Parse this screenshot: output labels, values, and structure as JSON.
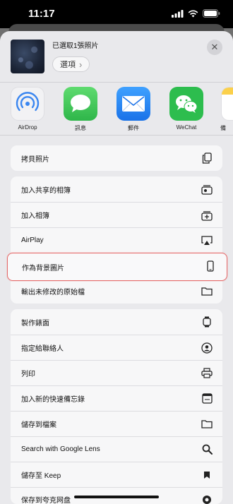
{
  "status": {
    "time": "11:17"
  },
  "header": {
    "title": "已選取1張照片",
    "options_label": "選項",
    "options_chevron": "›",
    "close_glyph": "✕"
  },
  "apps": [
    {
      "name": "airdrop",
      "label": "AirDrop",
      "icon": "airdrop-icon",
      "color": "#4a8ff0"
    },
    {
      "name": "messages",
      "label": "訊息",
      "icon": "messages-icon",
      "color": "#34c759"
    },
    {
      "name": "mail",
      "label": "郵件",
      "icon": "mail-icon",
      "color": "#2b8cf5"
    },
    {
      "name": "wechat",
      "label": "WeChat",
      "icon": "wechat-icon",
      "color": "#2dbd4e"
    },
    {
      "name": "notes",
      "label": "備",
      "icon": "notes-icon",
      "color": "#fbd04b"
    }
  ],
  "group1": [
    {
      "label": "拷貝照片",
      "icon": "copy-icon"
    }
  ],
  "group2": [
    {
      "label": "加入共享的相簿",
      "icon": "shared-album-icon"
    },
    {
      "label": "加入相簿",
      "icon": "add-album-icon"
    },
    {
      "label": "AirPlay",
      "icon": "airplay-icon"
    },
    {
      "label": "作為背景圖片",
      "icon": "phone-icon"
    },
    {
      "label": "輸出未修改的原始檔",
      "icon": "folder-icon"
    }
  ],
  "group3": [
    {
      "label": "製作錶面",
      "icon": "watch-icon"
    },
    {
      "label": "指定給聯絡人",
      "icon": "contact-icon"
    },
    {
      "label": "列印",
      "icon": "printer-icon"
    },
    {
      "label": "加入新的快速備忘錄",
      "icon": "quick-note-icon"
    },
    {
      "label": "儲存到檔案",
      "icon": "folder-icon"
    },
    {
      "label": "Search with Google Lens",
      "icon": "search-icon"
    },
    {
      "label": "儲存至 Keep",
      "icon": "bookmark-icon"
    },
    {
      "label": "保存到夸克网盘",
      "icon": "cloud-icon"
    }
  ],
  "colors": {
    "highlight_border": "#e56a6a",
    "sheet_bg": "#e9e9ec"
  }
}
